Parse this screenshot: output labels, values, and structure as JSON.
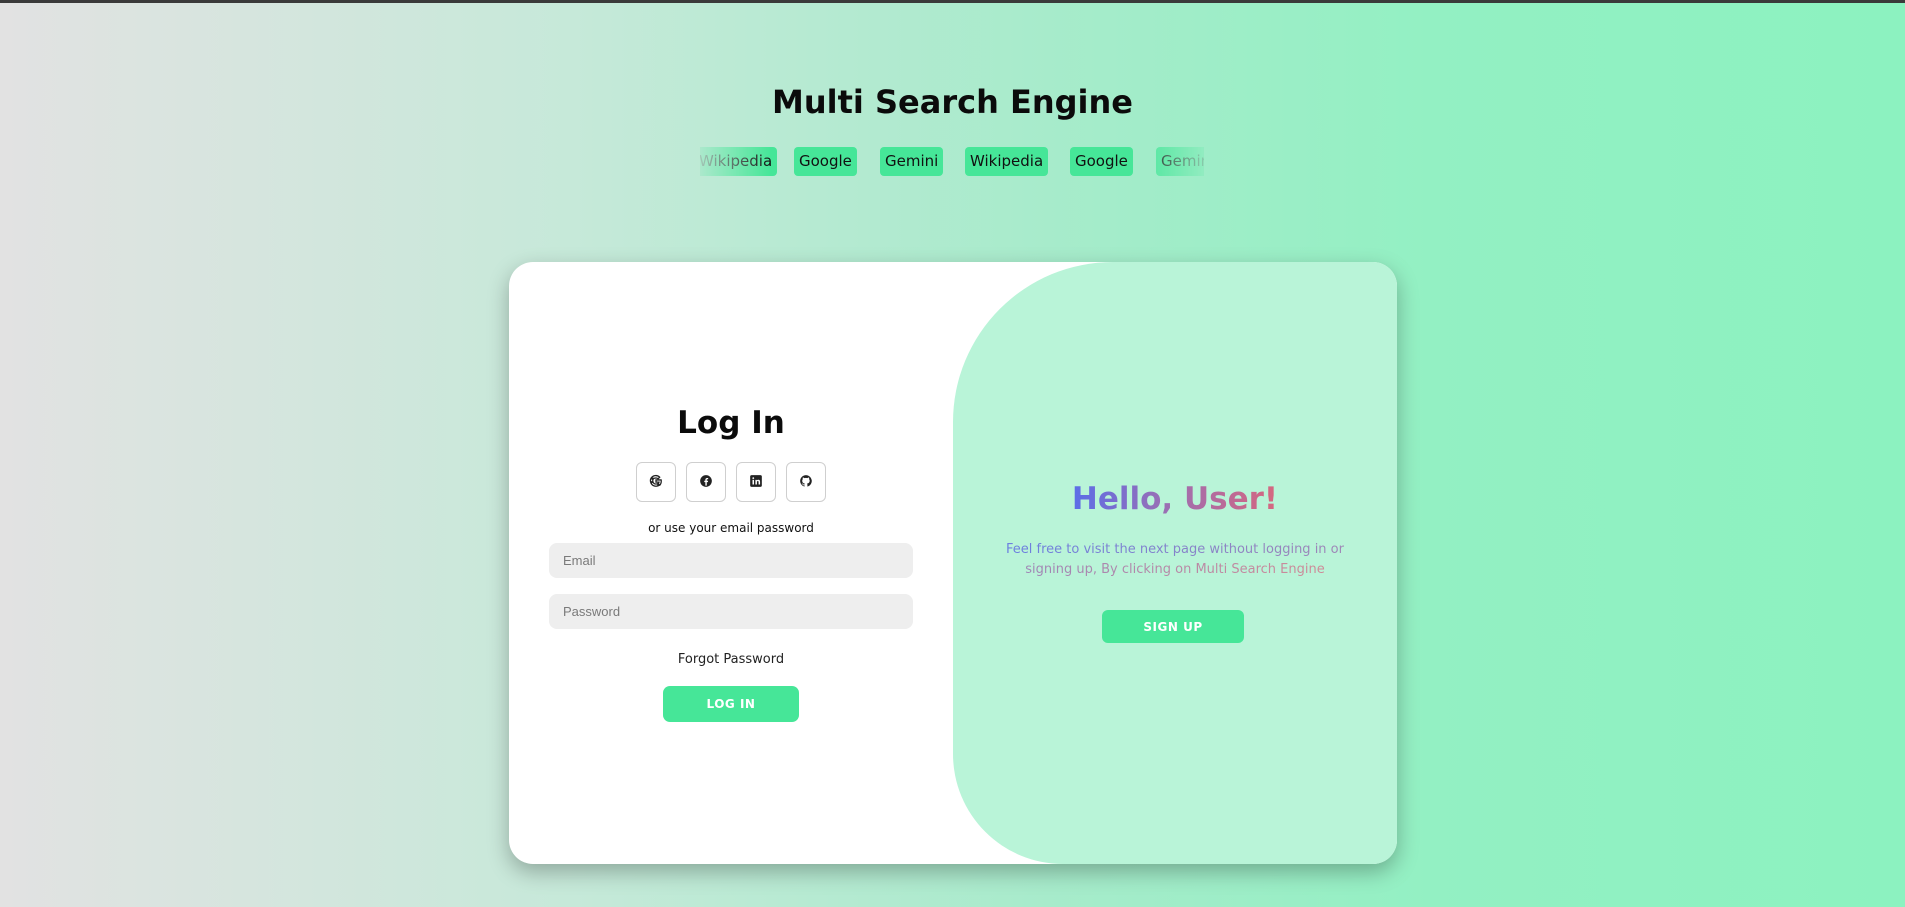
{
  "header": {
    "title": "Multi Search Engine"
  },
  "ticker": {
    "items": [
      "Wikipedia",
      "Google",
      "Gemini",
      "Wikipedia",
      "Google",
      "Gemini"
    ],
    "chip_color": "#46e698"
  },
  "login": {
    "title": "Log In",
    "social": [
      {
        "icon": "google-icon"
      },
      {
        "icon": "facebook-icon"
      },
      {
        "icon": "linkedin-icon"
      },
      {
        "icon": "github-icon"
      }
    ],
    "alt_text": "or use your email password",
    "email_placeholder": "Email",
    "password_placeholder": "Password",
    "forgot_label": "Forgot Password",
    "submit_label": "LOG IN"
  },
  "welcome": {
    "title": "Hello, User!",
    "message": "Feel free to visit the next page without logging in or signing up, By clicking on Multi Search Engine",
    "signup_label": "SIGN UP"
  },
  "colors": {
    "accent": "#46e698",
    "panel": "#b9f4d8"
  }
}
